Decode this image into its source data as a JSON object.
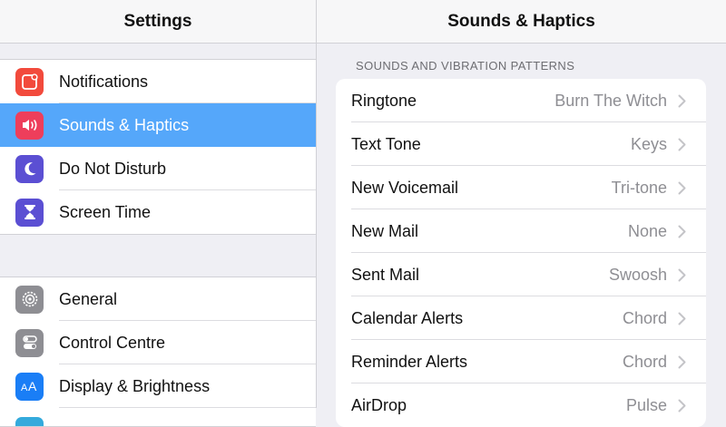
{
  "sidebar": {
    "title": "Settings",
    "groups": [
      {
        "items": [
          {
            "label": "Notifications",
            "icon": "notifications-icon",
            "color": "#f24a3c",
            "selected": false
          },
          {
            "label": "Sounds & Haptics",
            "icon": "speaker-icon",
            "color": "#ee3e5b",
            "selected": true
          },
          {
            "label": "Do Not Disturb",
            "icon": "moon-icon",
            "color": "#5b4fd3",
            "selected": false
          },
          {
            "label": "Screen Time",
            "icon": "hourglass-icon",
            "color": "#5b4fd3",
            "selected": false
          }
        ]
      },
      {
        "items": [
          {
            "label": "General",
            "icon": "gear-icon",
            "color": "#8e8e93",
            "selected": false
          },
          {
            "label": "Control Centre",
            "icon": "toggles-icon",
            "color": "#8e8e93",
            "selected": false
          },
          {
            "label": "Display & Brightness",
            "icon": "text-size-icon",
            "color": "#1a7ef6",
            "selected": false
          }
        ]
      }
    ]
  },
  "detail": {
    "title": "Sounds & Haptics",
    "section_header": "SOUNDS AND VIBRATION PATTERNS",
    "rows": [
      {
        "label": "Ringtone",
        "value": "Burn The Witch"
      },
      {
        "label": "Text Tone",
        "value": "Keys"
      },
      {
        "label": "New Voicemail",
        "value": "Tri-tone"
      },
      {
        "label": "New Mail",
        "value": "None"
      },
      {
        "label": "Sent Mail",
        "value": "Swoosh"
      },
      {
        "label": "Calendar Alerts",
        "value": "Chord"
      },
      {
        "label": "Reminder Alerts",
        "value": "Chord"
      },
      {
        "label": "AirDrop",
        "value": "Pulse"
      }
    ]
  }
}
